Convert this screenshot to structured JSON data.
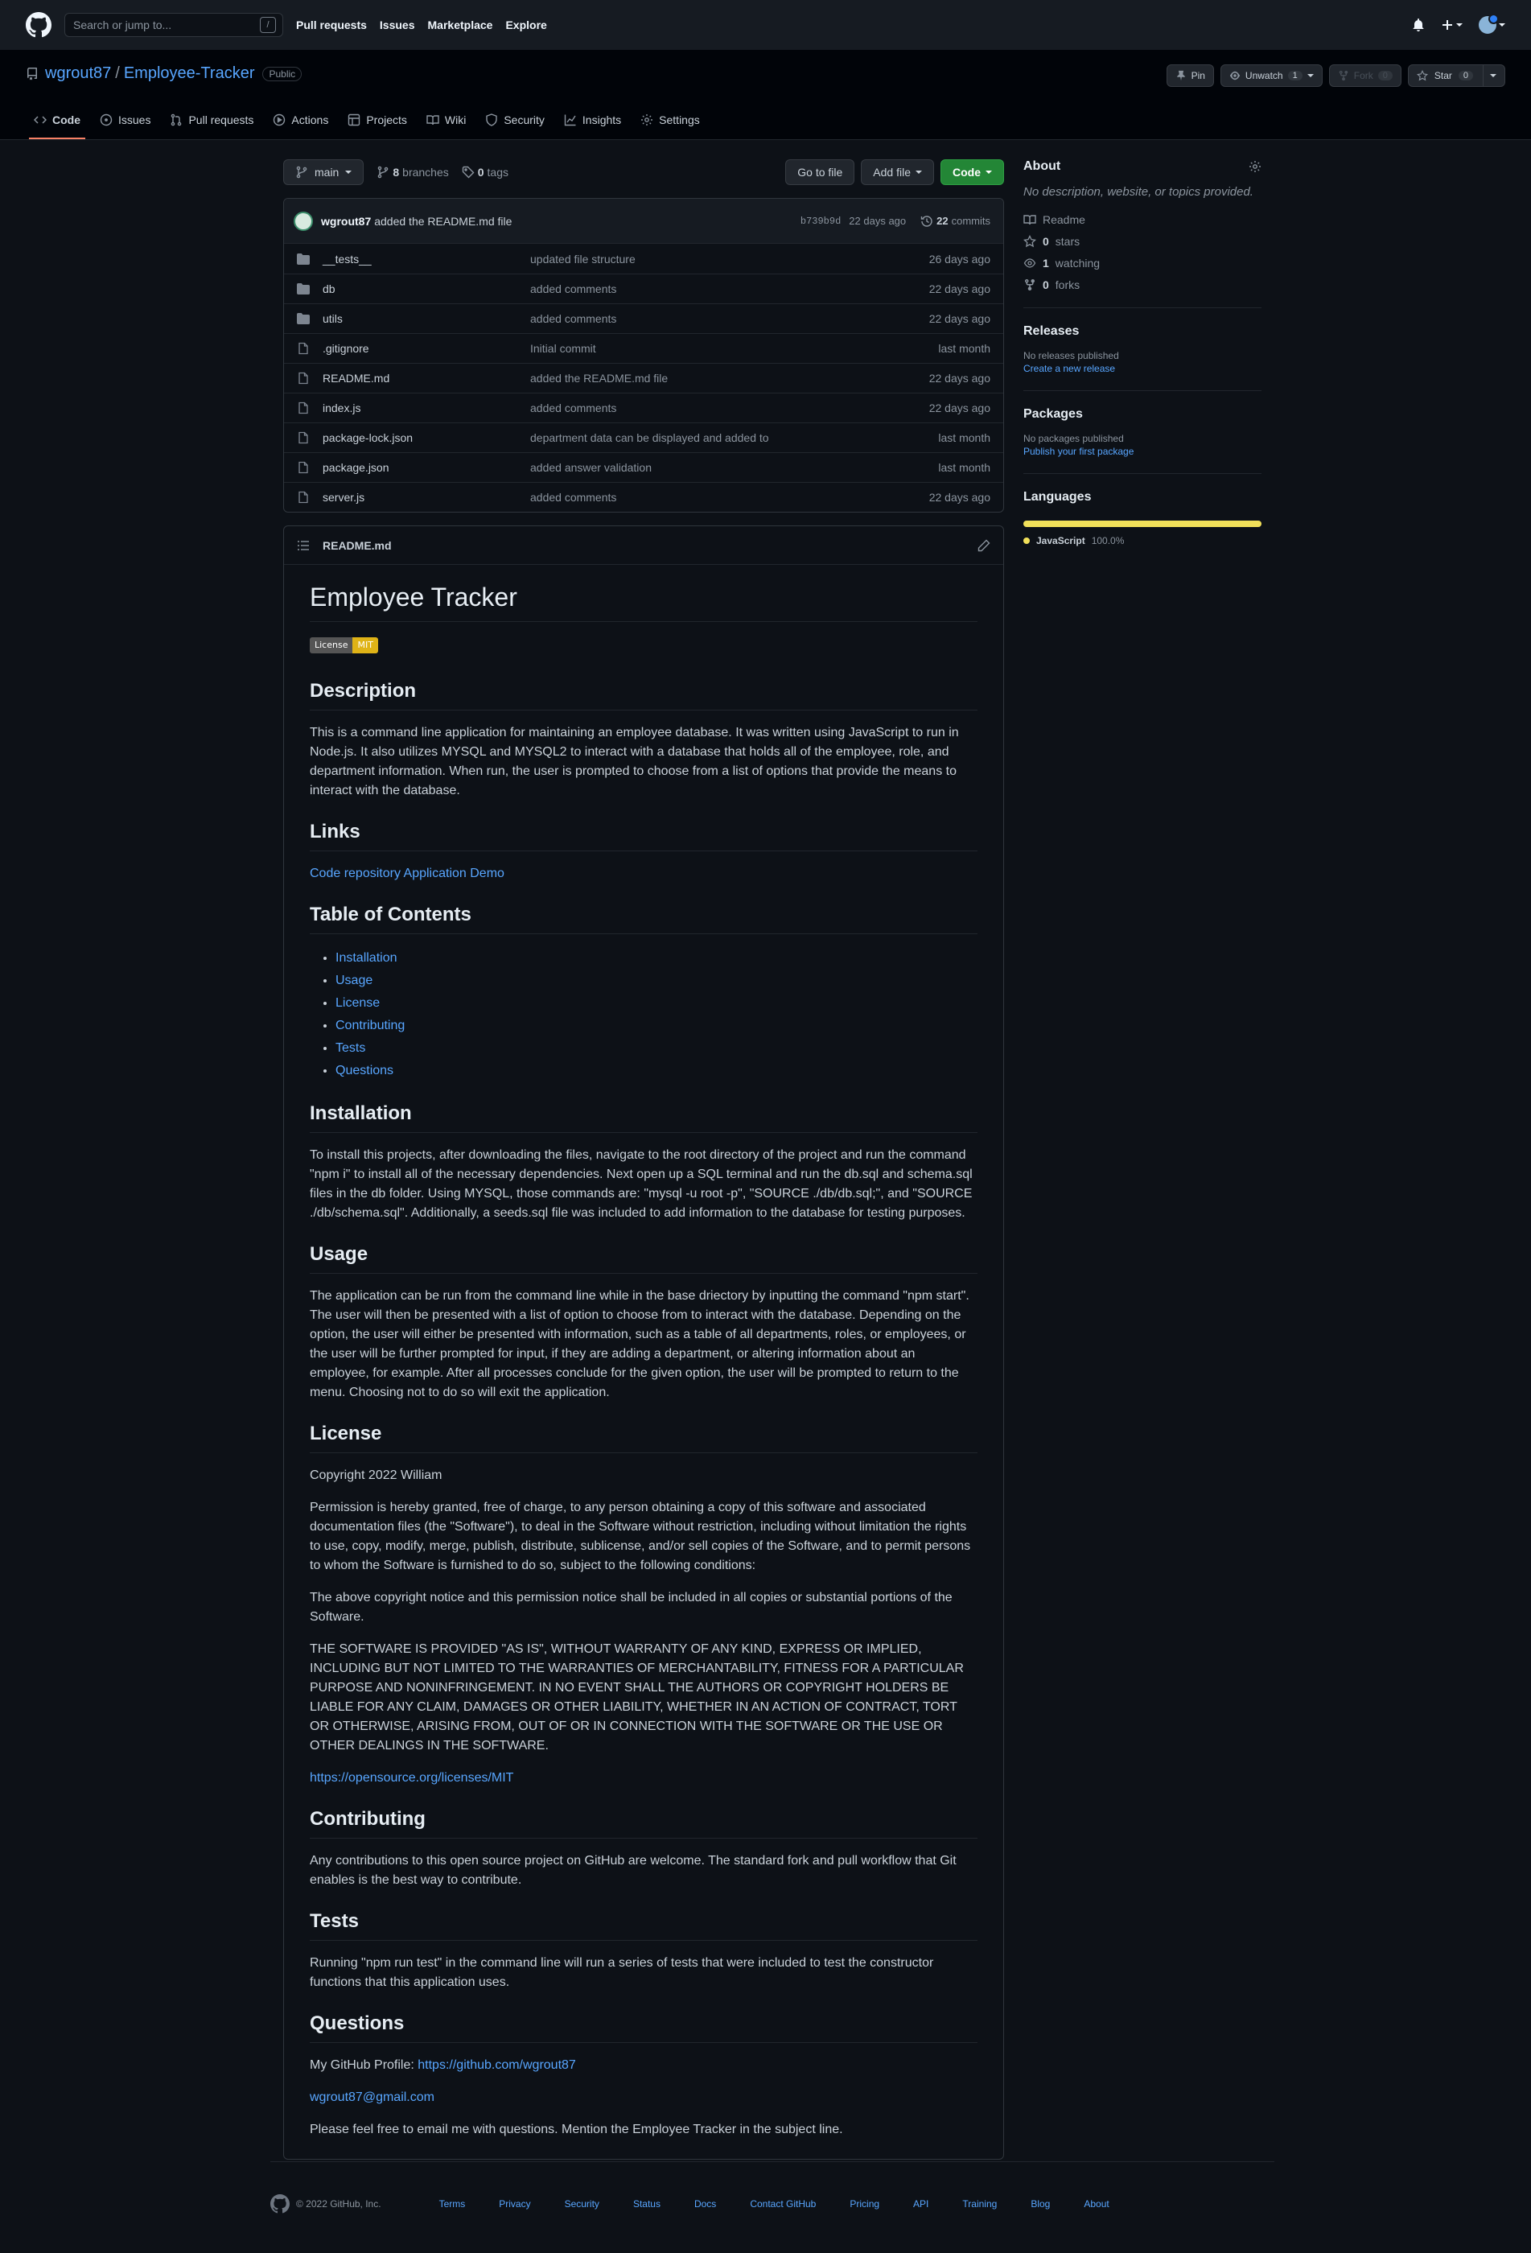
{
  "topbar": {
    "search_placeholder": "Search or jump to...",
    "slash_key": "/",
    "nav": [
      "Pull requests",
      "Issues",
      "Marketplace",
      "Explore"
    ]
  },
  "repo": {
    "owner": "wgrout87",
    "separator": "/",
    "name": "Employee-Tracker",
    "visibility": "Public",
    "actions": {
      "pin": "Pin",
      "unwatch": "Unwatch",
      "watch_count": "1",
      "fork": "Fork",
      "fork_count": "0",
      "star": "Star",
      "star_count": "0"
    },
    "tabs": [
      "Code",
      "Issues",
      "Pull requests",
      "Actions",
      "Projects",
      "Wiki",
      "Security",
      "Insights",
      "Settings"
    ]
  },
  "toolbar": {
    "branch": "main",
    "branches_count": "8",
    "branches_label": "branches",
    "tags_count": "0",
    "tags_label": "tags",
    "go_to_file": "Go to file",
    "add_file": "Add file",
    "code": "Code"
  },
  "commit": {
    "author": "wgrout87",
    "message": "added the README.md file",
    "sha": "b739b9d",
    "age": "22 days ago",
    "count": "22",
    "count_label": "commits"
  },
  "files": [
    {
      "name": "__tests__",
      "type": "dir",
      "message": "updated file structure",
      "age": "26 days ago"
    },
    {
      "name": "db",
      "type": "dir",
      "message": "added comments",
      "age": "22 days ago"
    },
    {
      "name": "utils",
      "type": "dir",
      "message": "added comments",
      "age": "22 days ago"
    },
    {
      "name": ".gitignore",
      "type": "file",
      "message": "Initial commit",
      "age": "last month"
    },
    {
      "name": "README.md",
      "type": "file",
      "message": "added the README.md file",
      "age": "22 days ago"
    },
    {
      "name": "index.js",
      "type": "file",
      "message": "added comments",
      "age": "22 days ago"
    },
    {
      "name": "package-lock.json",
      "type": "file",
      "message": "department data can be displayed and added to",
      "age": "last month"
    },
    {
      "name": "package.json",
      "type": "file",
      "message": "added answer validation",
      "age": "last month"
    },
    {
      "name": "server.js",
      "type": "file",
      "message": "added comments",
      "age": "22 days ago"
    }
  ],
  "readme": {
    "filename": "README.md",
    "title": "Employee Tracker",
    "badge_left": "License",
    "badge_right": "MIT",
    "h_description": "Description",
    "description": "This is a command line application for maintaining an employee database. It was written using JavaScript to run in Node.js. It also utilizes MYSQL and MYSQL2 to interact with a database that holds all of the employee, role, and department information. When run, the user is prompted to choose from a list of options that provide the means to interact with the database.",
    "h_links": "Links",
    "link_repo": "Code repository",
    "link_demo": "Application Demo",
    "h_toc": "Table of Contents",
    "toc": [
      "Installation",
      "Usage",
      "License",
      "Contributing",
      "Tests",
      "Questions"
    ],
    "h_installation": "Installation",
    "installation": "To install this projects, after downloading the files, navigate to the root directory of the project and run the command \"npm i\" to install all of the necessary dependencies. Next open up a SQL terminal and run the db.sql and schema.sql files in the db folder. Using MYSQL, those commands are: \"mysql -u root -p\", \"SOURCE ./db/db.sql;\", and \"SOURCE ./db/schema.sql\". Additionally, a seeds.sql file was included to add information to the database for testing purposes.",
    "h_usage": "Usage",
    "usage": "The application can be run from the command line while in the base driectory by inputting the command \"npm start\". The user will then be presented with a list of option to choose from to interact with the database. Depending on the option, the user will either be presented with information, such as a table of all departments, roles, or employees, or the user will be further prompted for input, if they are adding a department, or altering information about an employee, for example. After all processes conclude for the given option, the user will be prompted to return to the menu. Choosing not to do so will exit the application.",
    "h_license": "License",
    "copyright": "Copyright 2022 William",
    "license_p1": "Permission is hereby granted, free of charge, to any person obtaining a copy of this software and associated documentation files (the \"Software\"), to deal in the Software without restriction, including without limitation the rights to use, copy, modify, merge, publish, distribute, sublicense, and/or sell copies of the Software, and to permit persons to whom the Software is furnished to do so, subject to the following conditions:",
    "license_p2": "The above copyright notice and this permission notice shall be included in all copies or substantial portions of the Software.",
    "license_p3": "THE SOFTWARE IS PROVIDED \"AS IS\", WITHOUT WARRANTY OF ANY KIND, EXPRESS OR IMPLIED, INCLUDING BUT NOT LIMITED TO THE WARRANTIES OF MERCHANTABILITY, FITNESS FOR A PARTICULAR PURPOSE AND NONINFRINGEMENT. IN NO EVENT SHALL THE AUTHORS OR COPYRIGHT HOLDERS BE LIABLE FOR ANY CLAIM, DAMAGES OR OTHER LIABILITY, WHETHER IN AN ACTION OF CONTRACT, TORT OR OTHERWISE, ARISING FROM, OUT OF OR IN CONNECTION WITH THE SOFTWARE OR THE USE OR OTHER DEALINGS IN THE SOFTWARE.",
    "license_link": "https://opensource.org/licenses/MIT",
    "h_contributing": "Contributing",
    "contributing": "Any contributions to this open source project on GitHub are welcome. The standard fork and pull workflow that Git enables is the best way to contribute.",
    "h_tests": "Tests",
    "tests": "Running \"npm run test\" in the command line will run a series of tests that were included to test the constructor functions that this application uses.",
    "h_questions": "Questions",
    "profile_label": "My GitHub Profile:",
    "profile_link": "https://github.com/wgrout87",
    "email": "wgrout87@gmail.com",
    "closing": "Please feel free to email me with questions. Mention the Employee Tracker in the subject line."
  },
  "sidebar": {
    "about_title": "About",
    "about_desc": "No description, website, or topics provided.",
    "readme_label": "Readme",
    "stars_count": "0",
    "stars_label": "stars",
    "watching_count": "1",
    "watching_label": "watching",
    "forks_count": "0",
    "forks_label": "forks",
    "releases_title": "Releases",
    "releases_empty": "No releases published",
    "releases_link": "Create a new release",
    "packages_title": "Packages",
    "packages_empty": "No packages published",
    "packages_link": "Publish your first package",
    "languages_title": "Languages",
    "language_name": "JavaScript",
    "language_pct": "100.0%",
    "language_color": "#f1e05a"
  },
  "footer": {
    "copyright": "© 2022 GitHub, Inc.",
    "links": [
      "Terms",
      "Privacy",
      "Security",
      "Status",
      "Docs",
      "Contact GitHub",
      "Pricing",
      "API",
      "Training",
      "Blog",
      "About"
    ]
  }
}
